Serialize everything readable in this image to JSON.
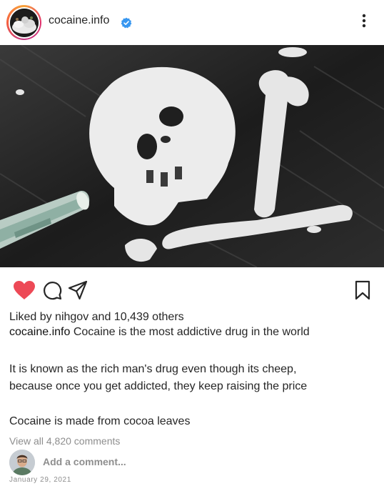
{
  "header": {
    "username": "cocaine.info",
    "verified_icon": "verified-badge-icon",
    "more_icon": "more-vertical-icon"
  },
  "actions": {
    "like_icon": "heart-filled-icon",
    "like_color": "#ed4956",
    "comment_icon": "comment-icon",
    "share_icon": "send-icon",
    "save_icon": "bookmark-icon"
  },
  "likes": {
    "prefix": "Liked by ",
    "user": "nihgov",
    "middle": " and ",
    "count": "10,439 others"
  },
  "caption": {
    "username": "cocaine.info",
    "line1": " Cocaine is the most addictive drug in the world",
    "line2": "It is known as the rich man's drug even though its cheep,",
    "line3": "because once you get addicted, they keep raising the price",
    "line4": "Cocaine is made from cocoa leaves"
  },
  "comments": {
    "view_all": "View all 4,820 comments",
    "placeholder": "Add a comment..."
  },
  "date": "January 29, 2021",
  "colors": {
    "text": "#262626",
    "muted": "#8e8e8e",
    "verified": "#3897f0"
  }
}
